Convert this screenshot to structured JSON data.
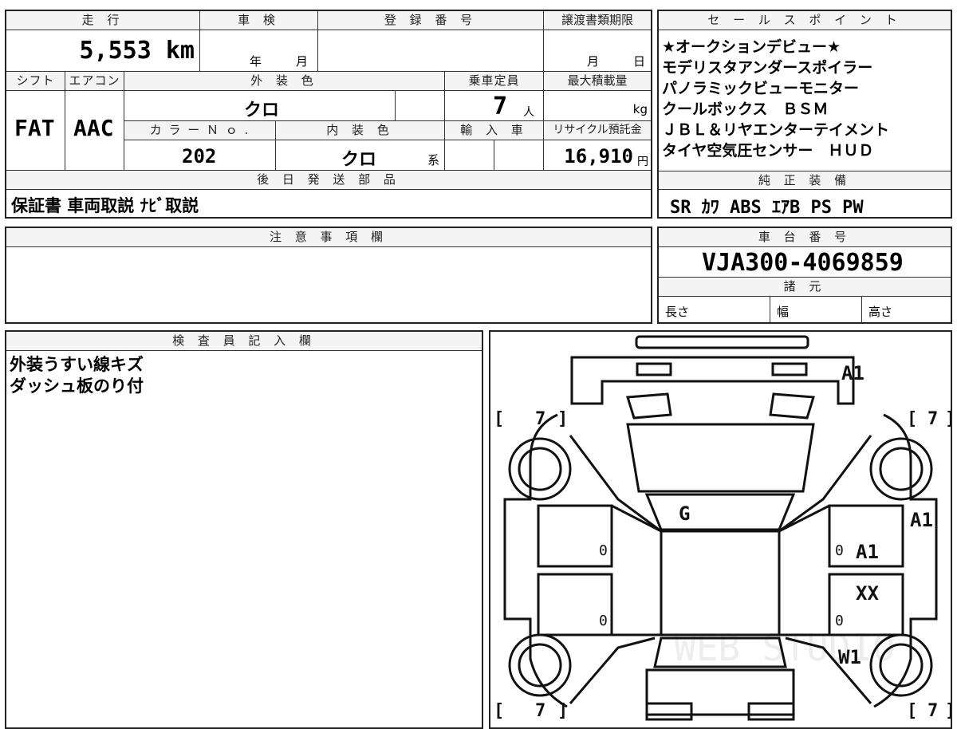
{
  "top_box": {
    "h_distance": "走 行",
    "h_inspection": "車 検",
    "h_registration": "登 録 番 号",
    "h_transfer_deadline": "譲渡書類期限",
    "mileage": "5,553 km",
    "year_unit": "年",
    "month_unit": "月",
    "deadline_month": "月",
    "deadline_day": "日",
    "h_shift": "シフト",
    "h_aircon": "エアコン",
    "h_exterior_color": "外 装 色",
    "h_capacity": "乗車定員",
    "h_max_load": "最大積載量",
    "shift": "FAT",
    "aircon": "AAC",
    "exterior_color": "クロ",
    "capacity": "7",
    "capacity_unit": "人",
    "load_unit": "kg",
    "h_color_no": "カ ラ ー Ｎ ｏ .",
    "h_interior_color": "内 装 色",
    "h_import": "輸 入 車",
    "h_recycle": "リサイクル預託金",
    "color_no": "202",
    "interior_color": "クロ",
    "interior_suffix": "系",
    "recycle_fee": "16,910",
    "yen_unit": "円",
    "h_later_parts": "後 日 発 送 部 品",
    "later_parts": "保証書 車両取説 ﾅﾋﾞ取説"
  },
  "sales_box": {
    "header": "セ ー ル ス ポ イ ン ト",
    "lines": [
      "★オークションデビュー★",
      "モデリスタアンダースポイラー",
      "パノラミックビューモニター",
      "クールボックス　ＢＳＭ",
      "ＪＢＬ＆リヤエンターテイメント",
      "タイヤ空気圧センサー　ＨＵＤ"
    ],
    "equip_header": "純 正 装 備",
    "equipment": "SR ｶﾜ ABS ｴｱB PS PW"
  },
  "notes_box": {
    "header": "注 意 事 項 欄",
    "content": ""
  },
  "chassis_box": {
    "header": "車 台 番 号",
    "chassis_no": "VJA300-4069859",
    "spec_header": "諸 元",
    "length": "長さ",
    "width": "幅",
    "height": "高さ"
  },
  "inspector_box": {
    "header": "検 査 員 記 入 欄",
    "lines": [
      "外装うすい線キズ",
      "ダッシュ板のり付"
    ]
  },
  "diagram": {
    "tire_depths": [
      "7",
      "7",
      "7",
      "7"
    ],
    "marks": {
      "front": "A1",
      "windshield": "G",
      "right_front_fender": "A1",
      "right_front_door": "A1",
      "right_rear_door": "XX",
      "right_rear_fender": "W1"
    },
    "zero_marks": [
      "0",
      "0",
      "0",
      "0"
    ],
    "watermark": "WEB STUDIO"
  }
}
